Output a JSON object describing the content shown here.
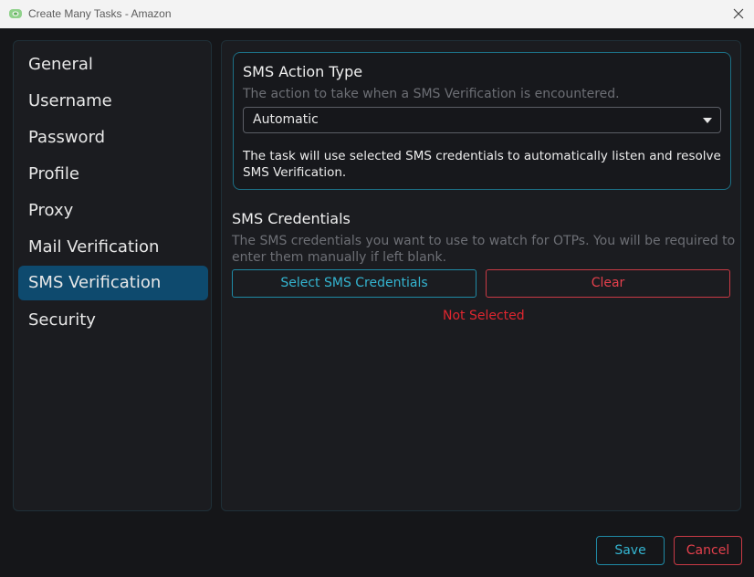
{
  "window": {
    "title": "Create Many Tasks - Amazon",
    "icon": "app-logo-icon"
  },
  "sidebar": {
    "items": [
      {
        "label": "General"
      },
      {
        "label": "Username"
      },
      {
        "label": "Password"
      },
      {
        "label": "Profile"
      },
      {
        "label": "Proxy"
      },
      {
        "label": "Mail Verification"
      },
      {
        "label": "SMS Verification",
        "active": true
      },
      {
        "label": "Security"
      }
    ]
  },
  "sms_action": {
    "heading": "SMS Action Type",
    "description": "The action to take when a SMS Verification is encountered.",
    "selected": "Automatic",
    "explanation_line1": "The task will use selected SMS credentials to automatically listen and resolve",
    "explanation_line2": "SMS Verification."
  },
  "sms_credentials": {
    "heading": "SMS Credentials",
    "description_line1": "The SMS credentials you want to use to watch for OTPs. You will be required to",
    "description_line2": "enter them manually if left blank.",
    "select_label": "Select SMS Credentials",
    "clear_label": "Clear",
    "status": "Not Selected"
  },
  "footer": {
    "save_label": "Save",
    "cancel_label": "Cancel"
  },
  "colors": {
    "accent": "#1f8aa6",
    "active_nav": "#0e4a6e",
    "danger": "#e0262f"
  }
}
